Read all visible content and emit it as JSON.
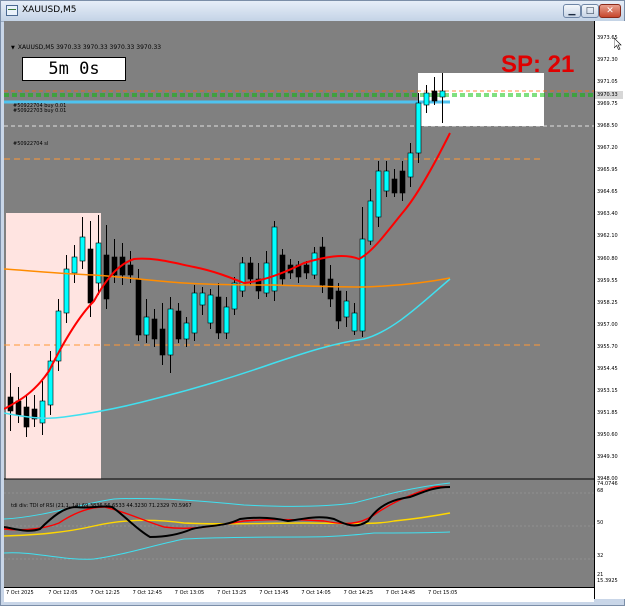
{
  "window": {
    "title": "XAUUSD,M5",
    "minimize": "▁",
    "maximize": "□",
    "close": "✕"
  },
  "chart_header": {
    "symbol": "XAUUSD,M5",
    "ohlc": "3970.33 3970.33 3970.33 3970.33"
  },
  "timer": "5m 0s",
  "spread": "SP: 21",
  "orders": {
    "buy_line_1": "#50922704 buy 0.01",
    "buy_line_2": "#50922703 buy 0.01",
    "sl_line": "#50922704 sl"
  },
  "price_axis": {
    "ticks": [
      "3973.65",
      "3972.30",
      "3971.05",
      "3969.75",
      "3968.50",
      "3967.20",
      "3965.95",
      "3964.65",
      "3963.40",
      "3962.10",
      "3960.80",
      "3959.55",
      "3958.25",
      "3957.00",
      "3955.70",
      "3954.45",
      "3953.15",
      "3951.85",
      "3950.60",
      "3949.30",
      "3948.00"
    ],
    "current_price": "3970.33"
  },
  "time_axis": {
    "ticks": [
      "7 Oct 2025",
      "7 Oct 12:05",
      "7 Oct 12:25",
      "7 Oct 12:45",
      "7 Oct 13:05",
      "7 Oct 13:25",
      "7 Oct 13:45",
      "7 Oct 14:05",
      "7 Oct 14:25",
      "7 Oct 14:45",
      "7 Oct 15:05"
    ]
  },
  "indicator": {
    "label": "tdi div: TDI of RSI  (21,1, 14) 69.3836 56.6533 44.3230 71.2329 70.5967",
    "ticks": [
      "74.0746",
      "68",
      "50",
      "32",
      "21",
      "15.3925"
    ]
  },
  "colors": {
    "chart_bg": "#808080",
    "bull_candle": "#00ffff",
    "bear_candle": "#000000",
    "ma_red": "#ff0000",
    "ma_orange": "#ff8c00",
    "ma_cyan": "#40e0f0",
    "spread_text": "#e00000",
    "session_box": "#ffe4e1"
  }
}
